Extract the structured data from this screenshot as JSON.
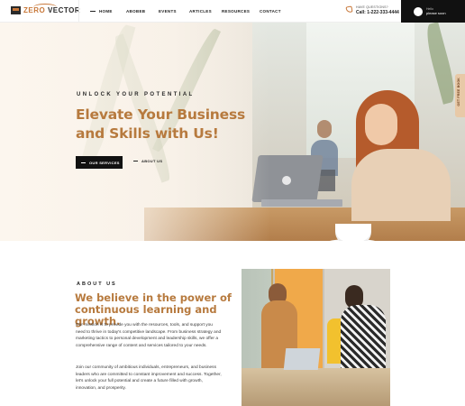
{
  "header": {
    "logo_prefix": "ZERO ",
    "logo_suffix": "VECTOR",
    "nav": [
      "HOME",
      "ABOBEB",
      "EVENTS",
      "ARTICLES",
      "RESOURCES",
      "CONTACT"
    ],
    "contact_label": "HAVE QUESTIONS?",
    "contact_number": "Call: 1-222-333-4444",
    "cta_small": "Hello",
    "cta_main": "please soon"
  },
  "hero": {
    "subtitle": "UNLOCK YOUR POTENTIAL",
    "title_line1": "Elevate Your Business",
    "title_line2": "and Skills with Us!",
    "primary_button": "OUR SERVICES",
    "secondary_button": "ABOUT US",
    "side_tab": "GET FREE BOOK"
  },
  "about": {
    "label": "ABOUT US",
    "title": "We believe in the power of continuous learning and growth.",
    "paragraph1": "Our mission is to provide you with the resources, tools, and support you need to thrive in today's competitive landscape. From business strategy and marketing tactics to personal development and leadership skills, we offer a comprehensive range of content and services tailored to your needs.",
    "paragraph2": "Join our community of ambitious individuals, entrepreneurs, and business leaders who are committed to constant improvement and success. Together, let's unlock your full potential and create a future filled with growth, innovation, and prosperity."
  },
  "colors": {
    "accent": "#b77a3e",
    "dark": "#111111"
  }
}
